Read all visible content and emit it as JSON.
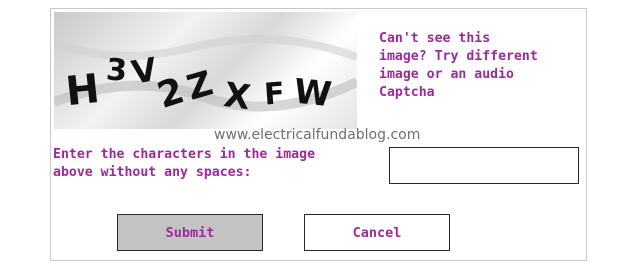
{
  "captcha": {
    "image_text": "H3V2ZXFW",
    "help_text": "Can't see this\nimage? Try different\nimage or an audio\nCaptcha"
  },
  "watermark": "www.electricalfundablog.com",
  "form": {
    "prompt": "Enter the characters in the image\nabove without any spaces:",
    "input_value": "",
    "input_placeholder": ""
  },
  "buttons": {
    "submit_label": "Submit",
    "cancel_label": "Cancel"
  },
  "colors": {
    "label_text": "#9b2a9b",
    "submit_bg": "#c4c4c4",
    "border": "#2a2a2a"
  }
}
